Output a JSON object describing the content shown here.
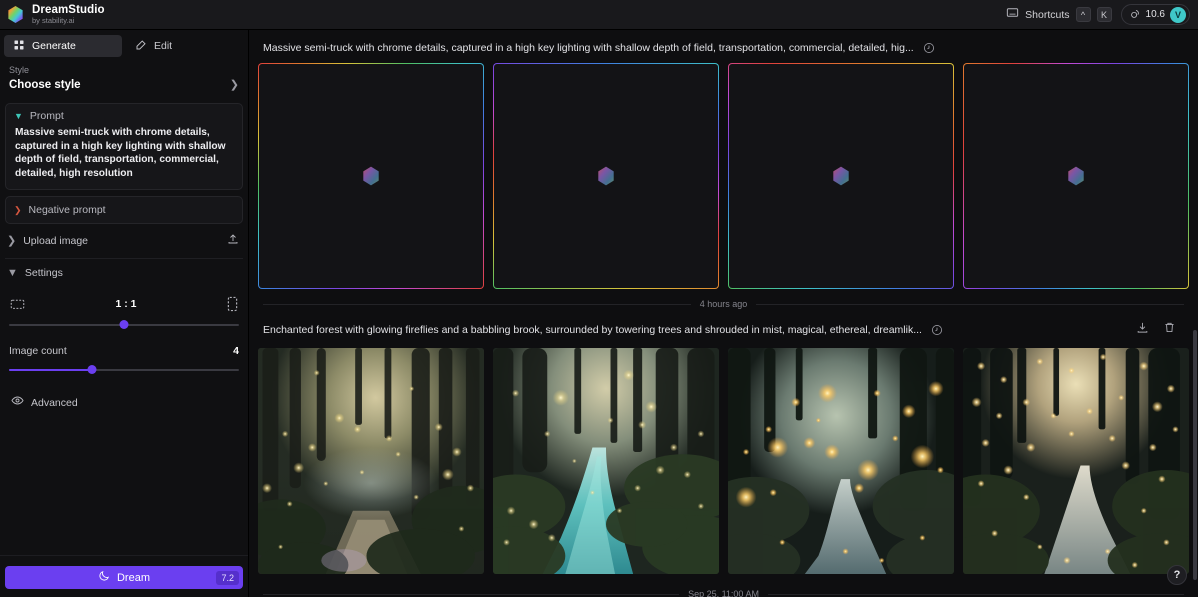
{
  "app": {
    "brand_name": "DreamStudio",
    "brand_sub": "by stability.ai",
    "logo_icon": "hexagon-gradient-logo"
  },
  "topbar": {
    "shortcuts_label": "Shortcuts",
    "shortcuts_icon": "keyboard-icon",
    "key_modifier": "^",
    "key_letter": "K",
    "credits_icon": "coin-icon",
    "credits_value": "10.6",
    "avatar_initial": "V"
  },
  "sidebar": {
    "tabs": [
      {
        "label": "Generate",
        "icon": "grid-icon",
        "active": true
      },
      {
        "label": "Edit",
        "icon": "pencil-square-icon",
        "active": false
      }
    ],
    "style": {
      "label": "Style",
      "value": "Choose style",
      "chevron_icon": "chevron-right-icon"
    },
    "prompt": {
      "title": "Prompt",
      "caret_icon": "chevron-down-icon",
      "text": "Massive semi-truck with chrome details, captured in a high key lighting with shallow depth of field, transportation, commercial, detailed, high resolution"
    },
    "negative_prompt": {
      "title": "Negative prompt",
      "caret_icon": "chevron-right-icon"
    },
    "upload_image": {
      "label": "Upload image",
      "caret_icon": "chevron-right-icon",
      "action_icon": "upload-icon"
    },
    "settings": {
      "label": "Settings",
      "caret_icon": "chevron-down-icon",
      "aspect_ratio": {
        "value": "1 : 1",
        "left_icon": "landscape-ratio-icon",
        "right_icon": "portrait-ratio-icon",
        "slider_percent": 50
      },
      "image_count": {
        "label": "Image count",
        "value": "4",
        "slider_percent": 36
      },
      "advanced": {
        "label": "Advanced",
        "icon": "eye-icon"
      }
    },
    "dream_button": {
      "label": "Dream",
      "icon": "moon-icon",
      "cost": "7.2"
    }
  },
  "main": {
    "generations": [
      {
        "prompt": "Massive semi-truck with chrome details, captured in a high key lighting with shallow depth of field, transportation, commercial, detailed, hig...",
        "info_icon": "clock-rewind-icon",
        "state": "loading",
        "timestamp": "4 hours ago",
        "placeholder_icon": "hexagon-gradient-logo",
        "cards": 4,
        "actions": []
      },
      {
        "prompt": "Enchanted forest with glowing fireflies and a babbling brook, surrounded by towering trees and shrouded in mist, magical, ethereal, dreamlik...",
        "info_icon": "clock-rewind-icon",
        "state": "done",
        "timestamp": "Sep 25, 11:00 AM",
        "cards": 4,
        "actions": [
          {
            "name": "download",
            "icon": "download-icon"
          },
          {
            "name": "delete",
            "icon": "trash-icon"
          }
        ]
      }
    ],
    "help_button_label": "?"
  },
  "colors": {
    "accent_purple": "#6b3ff0",
    "avatar_teal": "#3fc8c8",
    "caret_teal": "#3ec6b8",
    "caret_red": "#d4563f",
    "background": "#0e0e10",
    "panel": "#161619"
  }
}
